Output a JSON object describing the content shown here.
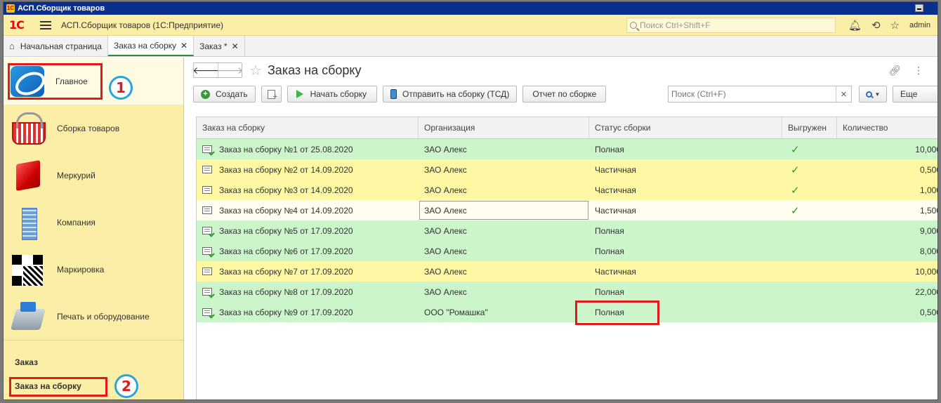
{
  "os_title": "АСП.Сборщик товаров",
  "header": {
    "logo": "1С",
    "app_title": "АСП.Сборщик товаров  (1С:Предприятие)",
    "search_placeholder": "Поиск Ctrl+Shift+F",
    "user": "admin"
  },
  "tabs": [
    {
      "label": "Начальная страница"
    },
    {
      "label": "Заказ на сборку"
    },
    {
      "label": "Заказ *"
    }
  ],
  "sidebar": {
    "items": [
      {
        "label": "Главное"
      },
      {
        "label": "Сборка товаров"
      },
      {
        "label": "Меркурий"
      },
      {
        "label": "Компания"
      },
      {
        "label": "Маркировка"
      },
      {
        "label": "Печать и оборудование"
      }
    ],
    "section_title": "Заказ",
    "section_item": "Заказ на сборку"
  },
  "form": {
    "title": "Заказ на сборку",
    "toolbar": {
      "create": "Создать",
      "start": "Начать сборку",
      "send": "Отправить на сборку (ТСД)",
      "report": "Отчет по сборке",
      "search_placeholder": "Поиск (Ctrl+F)",
      "more": "Еще"
    }
  },
  "table": {
    "columns": [
      "Заказ на сборку",
      "Организация",
      "Статус сборки",
      "Выгружен",
      "Количество"
    ],
    "rows": [
      {
        "order": "Заказ на сборку №1 от 25.08.2020",
        "org": "ЗАО Алекс",
        "status": "Полная",
        "exported": true,
        "qty": "10,000"
      },
      {
        "order": "Заказ на сборку №2 от 14.09.2020",
        "org": "ЗАО Алекс",
        "status": "Частичная",
        "exported": true,
        "qty": "0,500"
      },
      {
        "order": "Заказ на сборку №3 от 14.09.2020",
        "org": "ЗАО Алекс",
        "status": "Частичная",
        "exported": true,
        "qty": "1,000"
      },
      {
        "order": "Заказ на сборку №4 от 14.09.2020",
        "org": "ЗАО Алекс",
        "status": "Частичная",
        "exported": true,
        "qty": "1,500"
      },
      {
        "order": "Заказ на сборку №5 от 17.09.2020",
        "org": "ЗАО Алекс",
        "status": "Полная",
        "exported": false,
        "qty": "9,000"
      },
      {
        "order": "Заказ на сборку №6 от 17.09.2020",
        "org": "ЗАО Алекс",
        "status": "Полная",
        "exported": false,
        "qty": "8,000"
      },
      {
        "order": "Заказ на сборку №7 от 17.09.2020",
        "org": "ЗАО Алекс",
        "status": "Частичная",
        "exported": false,
        "qty": "10,000"
      },
      {
        "order": "Заказ на сборку №8 от 17.09.2020",
        "org": "ЗАО Алекс",
        "status": "Полная",
        "exported": false,
        "qty": "22,000"
      },
      {
        "order": "Заказ на сборку №9 от 17.09.2020",
        "org": "ООО \"Ромашка\"",
        "status": "Полная",
        "exported": false,
        "qty": "0,500"
      }
    ]
  },
  "annotations": {
    "marker1": "1",
    "marker2": "2"
  },
  "colors": {
    "row_full": "#ccf5cc",
    "row_partial": "#fef7a3",
    "row_selected": "#fffdf0",
    "highlight": "#e01b1b",
    "marker_ring": "#2aa4df"
  }
}
